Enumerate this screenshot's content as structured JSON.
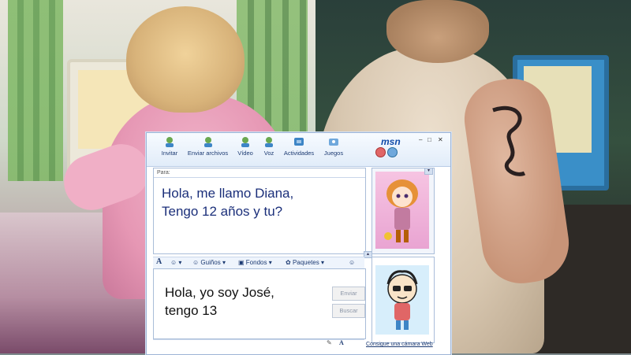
{
  "toolbar": {
    "invite": "Invitar",
    "send_files": "Enviar archivos",
    "video": "Vídeo",
    "voice": "Voz",
    "activities": "Actividades",
    "games": "Juegos"
  },
  "brand": {
    "logo": "msn"
  },
  "conversation": {
    "to_label": "Para:",
    "received_line1": "Hola, me llamo Diana,",
    "received_line2": "Tengo 12 años y tu?"
  },
  "format_bar": {
    "font_glyph": "A",
    "winks": "Guiños",
    "backgrounds": "Fondos",
    "packs": "Paquetes"
  },
  "compose": {
    "line1": "Hola, yo soy José,",
    "line2": "tengo 13",
    "send_label": "Enviar",
    "search_label": "Buscar"
  },
  "links": {
    "webcam": "Consigue una cámara Web"
  },
  "colors": {
    "msn_blue": "#0f4aa8",
    "message_blue": "#1b2f7a",
    "frame_border": "#a9bdd9"
  }
}
